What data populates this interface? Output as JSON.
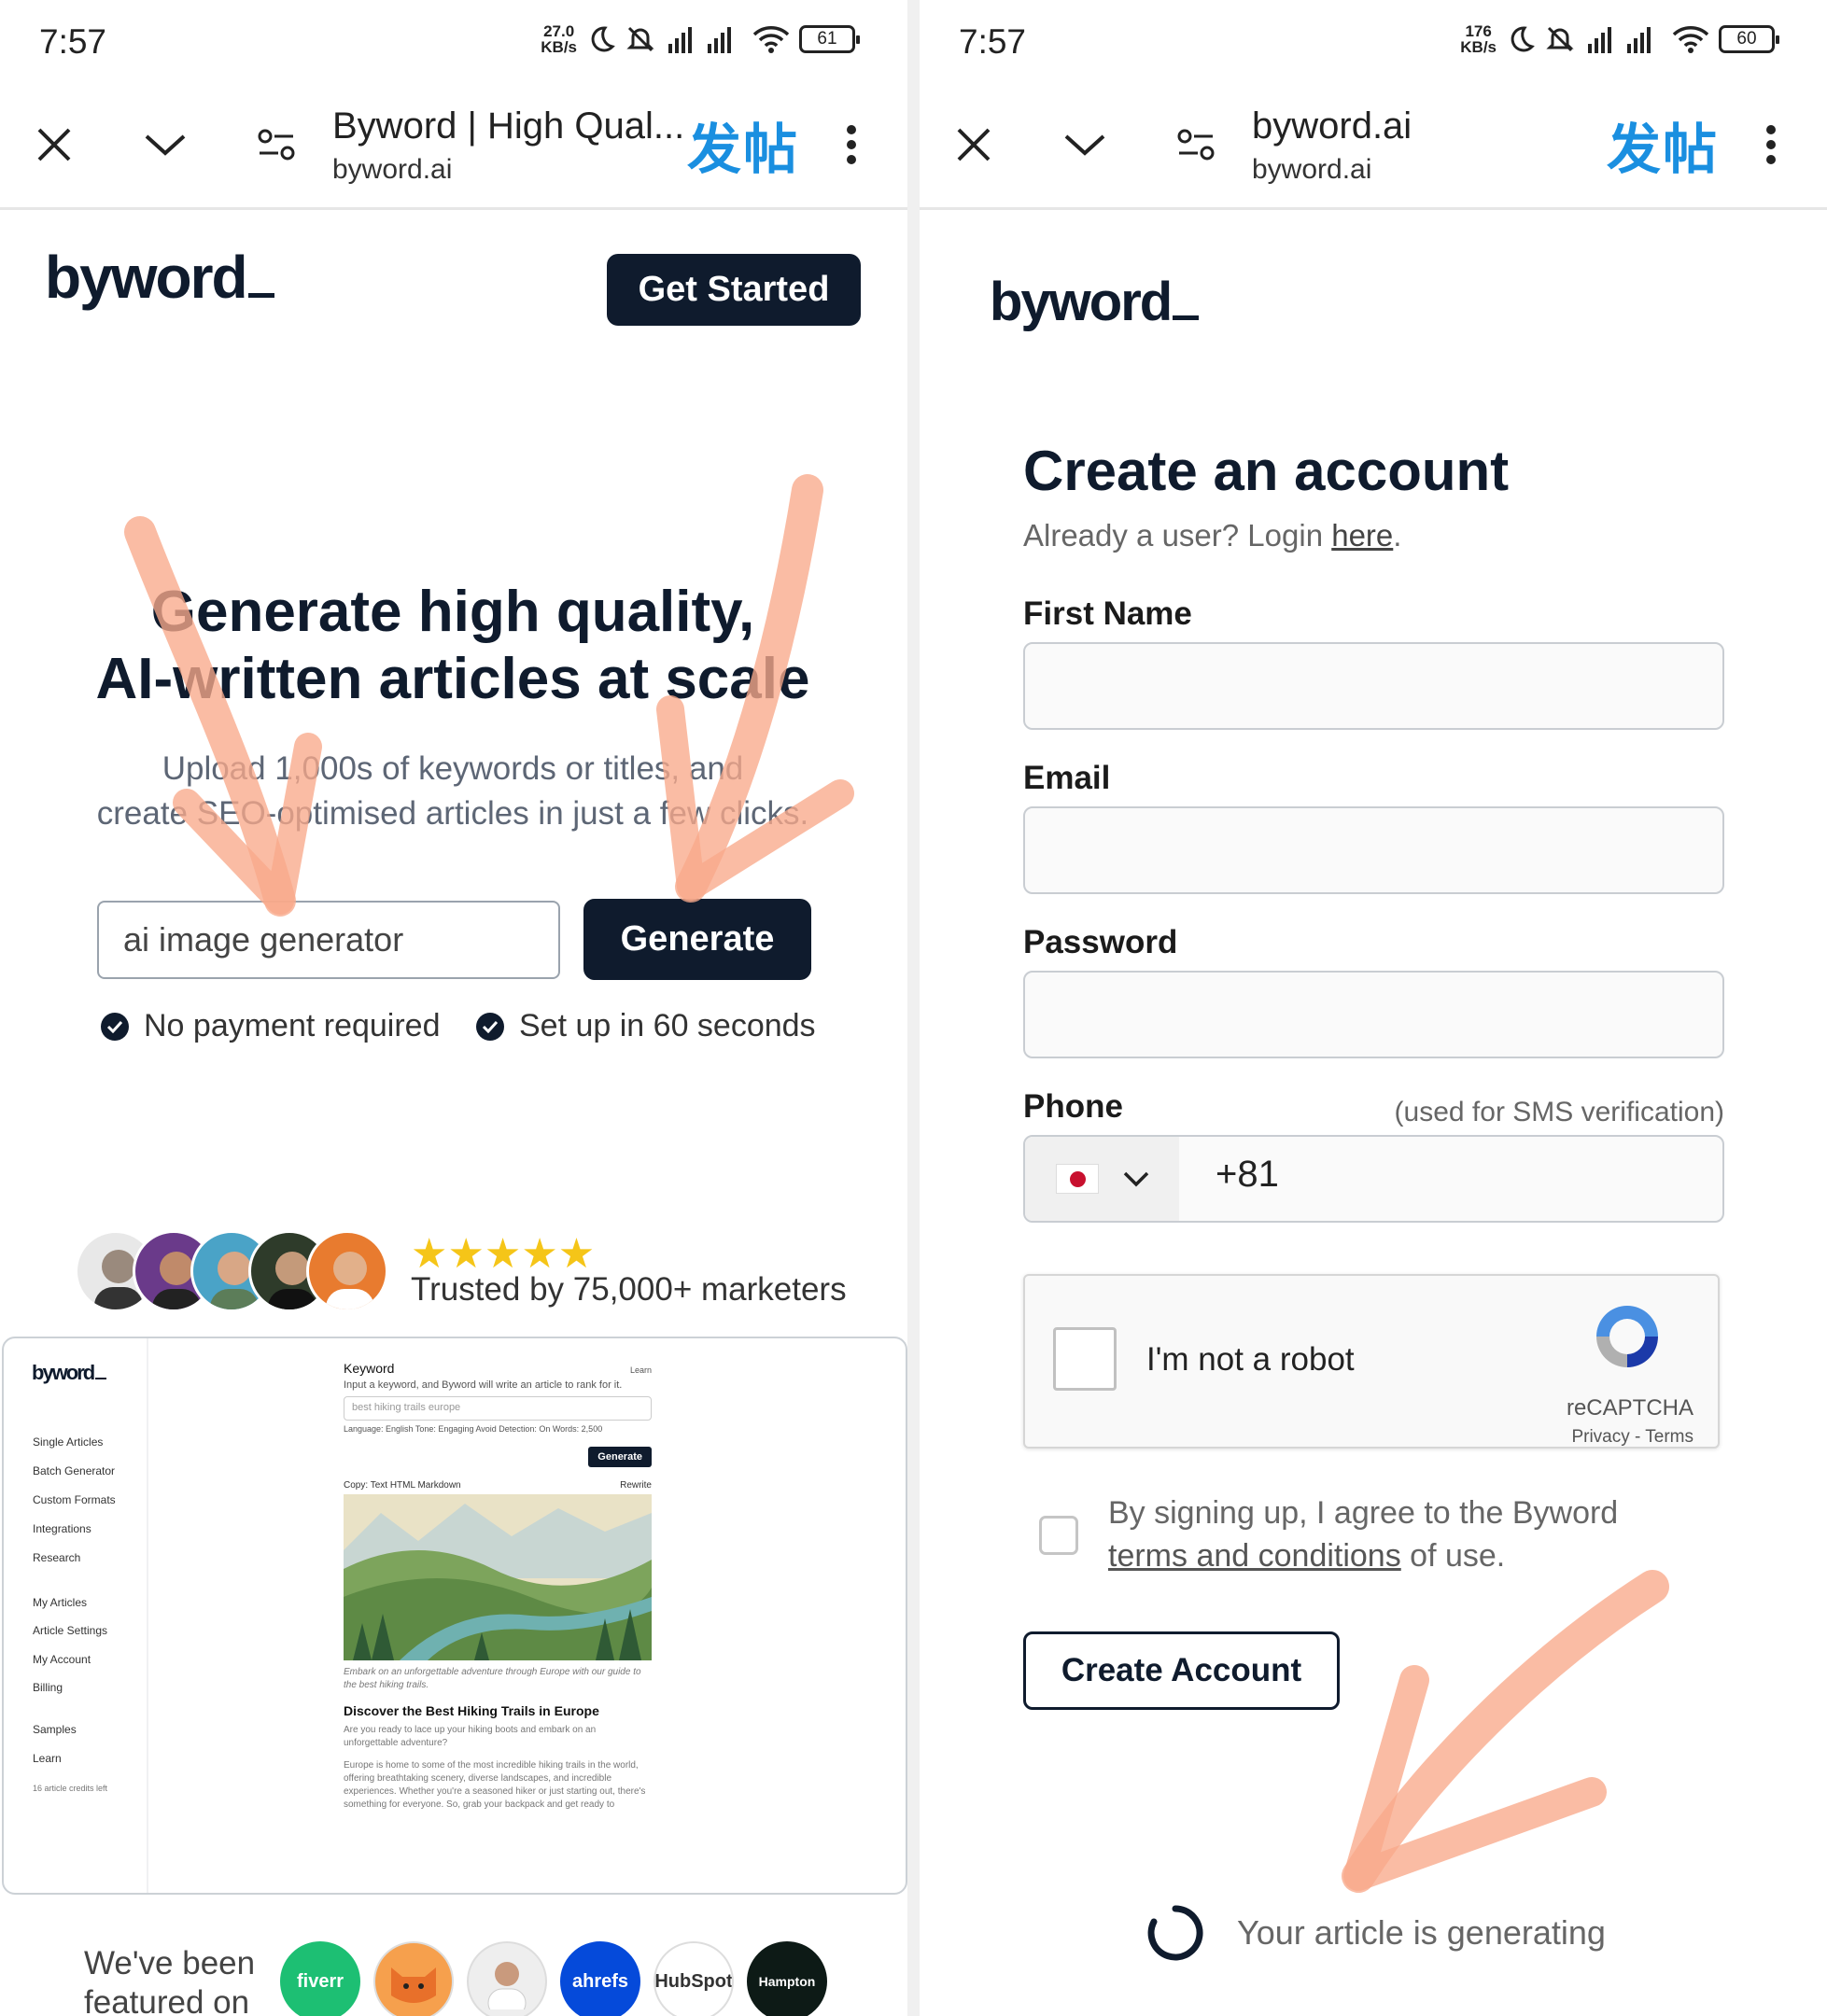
{
  "left_screen": {
    "status": {
      "time": "7:57",
      "speed_value": "27.0",
      "speed_unit": "KB/s",
      "battery": "61"
    },
    "browser": {
      "title": "Byword | High Qual...",
      "url": "byword.ai",
      "post_label": "发帖"
    },
    "header": {
      "logo": "byword",
      "cta": "Get Started"
    },
    "hero": {
      "title_line1": "Generate high quality,",
      "title_line2": "AI-written articles at scale",
      "subtitle_line1": "Upload 1,000s of keywords or titles, and",
      "subtitle_line2": "create SEO-optimised articles in just a few clicks.",
      "input_value": "ai image generator",
      "generate_label": "Generate",
      "check1": "No payment required",
      "check2": "Set up in 60 seconds"
    },
    "social_proof": {
      "stars": "★★★★★",
      "text": "Trusted by 75,000+ marketers"
    },
    "preview": {
      "logo": "byword",
      "sidebar": [
        "Single Articles",
        "Batch Generator",
        "Custom Formats",
        "Integrations",
        "Research",
        "My Articles",
        "Article Settings",
        "My Account",
        "Billing",
        "Samples",
        "Learn",
        "16 article credits left"
      ],
      "keyword_label": "Keyword",
      "learn": "Learn",
      "keyword_help": "Input a keyword, and Byword will write an article to rank for it.",
      "keyword_value": "best hiking trails europe",
      "options": "Language: English   Tone: Engaging   Avoid Detection: On   Words: 2,500",
      "generate": "Generate",
      "copy_tabs": "Copy:  Text   HTML   Markdown",
      "rewrite": "Rewrite",
      "caption": "Embark on an unforgettable adventure through Europe with our guide to the best hiking trails.",
      "article_title": "Discover the Best Hiking Trails in Europe",
      "article_intro": "Are you ready to lace up your hiking boots and embark on an unforgettable adventure?",
      "article_body": "Europe is home to some of the most incredible hiking trails in the world, offering breathtaking scenery, diverse landscapes, and incredible experiences. Whether you're a seasoned hiker or just starting out, there's something for everyone. So, grab your backpack and get ready to"
    },
    "featured": {
      "line1": "We've been",
      "line2": "featured on",
      "brands": [
        "fiverr",
        "",
        "",
        "ahrefs",
        "HubSpot",
        "Hampton"
      ]
    }
  },
  "right_screen": {
    "status": {
      "time": "7:57",
      "speed_value": "176",
      "speed_unit": "KB/s",
      "battery": "60"
    },
    "browser": {
      "title": "byword.ai",
      "url": "byword.ai",
      "post_label": "发帖"
    },
    "header": {
      "logo": "byword"
    },
    "form": {
      "title": "Create an account",
      "login_prefix": "Already a user? Login ",
      "login_link": "here",
      "login_suffix": ".",
      "first_name_label": "First Name",
      "email_label": "Email",
      "password_label": "Password",
      "phone_label": "Phone",
      "phone_note": "(used for SMS verification)",
      "dial_code": "+81",
      "captcha_text": "I'm not a robot",
      "captcha_brand": "reCAPTCHA",
      "captcha_links": "Privacy - Terms",
      "agree_prefix": "By signing up, I agree to the Byword",
      "agree_link": "terms and conditions",
      "agree_suffix": " of use.",
      "create_button": "Create Account",
      "generating_text": "Your article is generating"
    }
  },
  "colors": {
    "brand_navy": "#0f1b2d",
    "accent_blue": "#1a8fe0",
    "arrow_overlay": "#f9a98b",
    "star": "#f5c518"
  }
}
